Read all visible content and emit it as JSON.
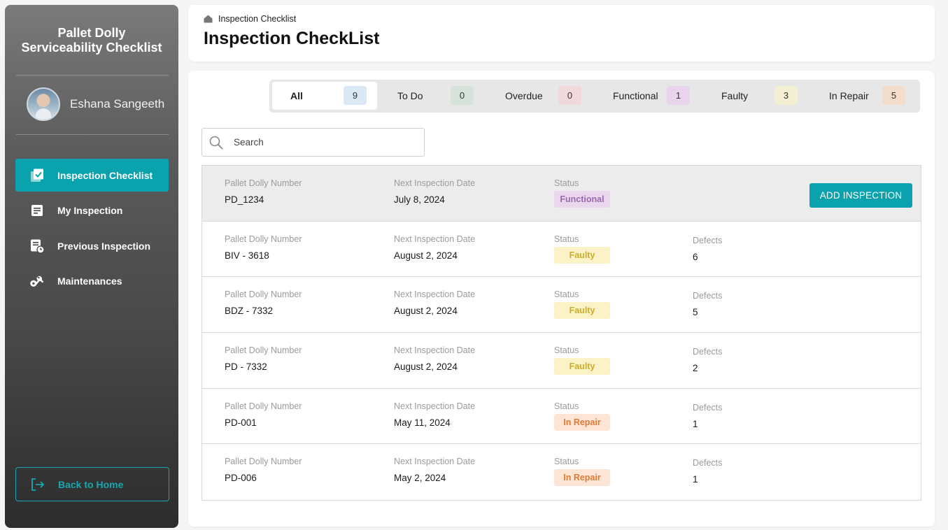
{
  "sidebar": {
    "app_title_line1": "Pallet Dolly",
    "app_title_line2": "Serviceability Checklist",
    "user_name": "Eshana Sangeeth",
    "nav": [
      {
        "label": "Inspection Checklist",
        "icon": "clipboard-check-icon",
        "active": true
      },
      {
        "label": "My Inspection",
        "icon": "document-icon",
        "active": false
      },
      {
        "label": "Previous Inspection",
        "icon": "document-clock-icon",
        "active": false
      },
      {
        "label": "Maintenances",
        "icon": "tools-icon",
        "active": false
      }
    ],
    "back_label": "Back to Home"
  },
  "header": {
    "breadcrumb": "Inspection Checklist",
    "title": "Inspection CheckList"
  },
  "tabs": [
    {
      "label": "All",
      "count": "9",
      "color": "#dbe9f6"
    },
    {
      "label": "To Do",
      "count": "0",
      "color": "#d6e3da"
    },
    {
      "label": "Overdue",
      "count": "0",
      "color": "#f1d9db"
    },
    {
      "label": "Functional",
      "count": "1",
      "color": "#e8d5ec"
    },
    {
      "label": "Faulty",
      "count": "3",
      "color": "#f3efd3"
    },
    {
      "label": "In Repair",
      "count": "5",
      "color": "#f4dccb"
    }
  ],
  "search": {
    "placeholder": "Search"
  },
  "table": {
    "col_number": "Pallet Dolly Number",
    "col_date": "Next Inspection Date",
    "col_status": "Status",
    "col_defects": "Defects",
    "add_label": "ADD INSPECTION",
    "rows": [
      {
        "number": "PD_1234",
        "date": "July 8, 2024",
        "status": "Functional",
        "defects": ""
      },
      {
        "number": "BIV - 3618",
        "date": "August 2, 2024",
        "status": "Faulty",
        "defects": "6"
      },
      {
        "number": "BDZ - 7332",
        "date": "August 2, 2024",
        "status": "Faulty",
        "defects": "5"
      },
      {
        "number": "PD - 7332",
        "date": "August 2, 2024",
        "status": "Faulty",
        "defects": "2"
      },
      {
        "number": "PD-001",
        "date": "May 11, 2024",
        "status": "In Repair",
        "defects": "1"
      },
      {
        "number": "PD-006",
        "date": "May 2, 2024",
        "status": "In Repair",
        "defects": "1"
      }
    ]
  },
  "colors": {
    "accent": "#0aa3ad"
  }
}
